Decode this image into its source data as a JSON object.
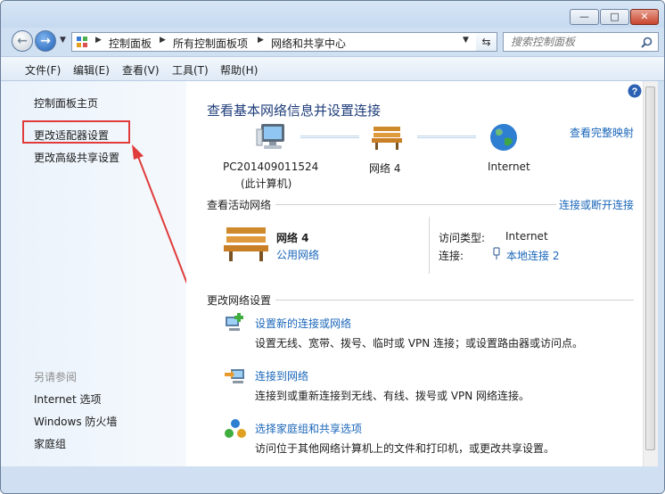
{
  "window": {
    "minimize": "—",
    "maximize": "□",
    "close": "✕"
  },
  "address": {
    "crumbs": [
      "控制面板",
      "所有控制面板项",
      "网络和共享中心"
    ],
    "search_placeholder": "搜索控制面板"
  },
  "menu": [
    "文件(F)",
    "编辑(E)",
    "查看(V)",
    "工具(T)",
    "帮助(H)"
  ],
  "sidebar": {
    "home": "控制面板主页",
    "adapter": "更改适配器设置",
    "advanced": "更改高级共享设置",
    "see_also_title": "另请参阅",
    "see_also": [
      "Internet 选项",
      "Windows 防火墙",
      "家庭组"
    ]
  },
  "main": {
    "title": "查看基本网络信息并设置连接",
    "full_map": "查看完整映射",
    "computer_name": "PC201409011524",
    "computer_sub": "(此计算机)",
    "network_node": "网络  4",
    "internet_node": "Internet",
    "active_title": "查看活动网络",
    "connect_link": "连接或断开连接",
    "network_name": "网络  4",
    "network_type": "公用网络",
    "access_label": "访问类型:",
    "access_value": "Internet",
    "connection_label": "连接:",
    "connection_value": "本地连接 2",
    "change_title": "更改网络设置",
    "tasks": [
      {
        "link": "设置新的连接或网络",
        "desc": "设置无线、宽带、拨号、临时或 VPN 连接；或设置路由器或访问点。"
      },
      {
        "link": "连接到网络",
        "desc": "连接到或重新连接到无线、有线、拨号或 VPN 网络连接。"
      },
      {
        "link": "选择家庭组和共享选项",
        "desc": "访问位于其他网络计算机上的文件和打印机，或更改共享设置。"
      }
    ]
  }
}
